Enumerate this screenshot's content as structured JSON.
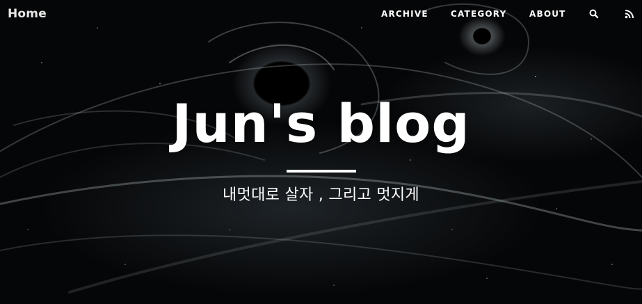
{
  "nav": {
    "brand": "Home",
    "items": [
      {
        "label": "ARCHIVE"
      },
      {
        "label": "CATEGORY"
      },
      {
        "label": "ABOUT"
      }
    ],
    "icons": [
      "search-icon",
      "rss-icon"
    ]
  },
  "hero": {
    "title": "Jun's blog",
    "subtitle": "내멋대로 살자 , 그리고 멋지게"
  },
  "colors": {
    "background": "#050607",
    "text": "#ffffff"
  }
}
